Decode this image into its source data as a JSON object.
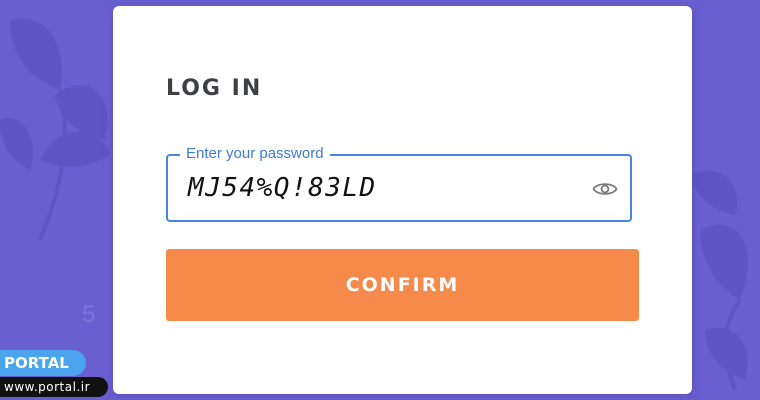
{
  "login": {
    "title": "LOG IN",
    "password_label": "Enter your password",
    "password_value": "MJ54%Q!83LD",
    "confirm_label": "CONFIRM"
  },
  "icons": {
    "toggle_visibility": "eye-icon"
  },
  "watermark": {
    "badge": "PORTAL",
    "url": "www.portal.ir"
  },
  "colors": {
    "background": "#6a5fd0",
    "card": "#ffffff",
    "accent_blue": "#4a86d9",
    "confirm_orange": "#f58a4b",
    "title_text": "#3f3f46"
  }
}
